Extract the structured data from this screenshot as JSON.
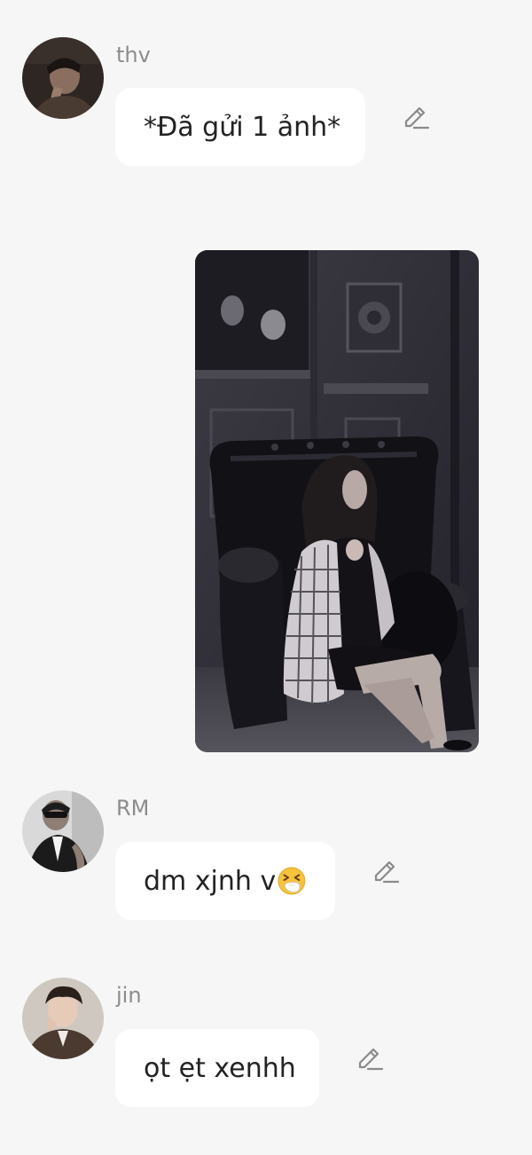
{
  "messages": [
    {
      "sender": "thv",
      "text": "*Đã gửi 1 ảnh*",
      "avatar_icon": "avatar-thv-photo",
      "edit_icon": "pencil-edit-icon"
    },
    {
      "sender": "RM",
      "text": "dm xjnh v",
      "emoji": "sneezing-face-emoji",
      "avatar_icon": "avatar-rm-photo",
      "edit_icon": "pencil-edit-icon"
    },
    {
      "sender": "jin",
      "text": "ọt ẹt xenhh",
      "avatar_icon": "avatar-jin-photo",
      "edit_icon": "pencil-edit-icon"
    }
  ],
  "attachment": {
    "type": "image",
    "subject": "woman-seated-in-black-leather-armchair-photo"
  },
  "colors": {
    "background": "#f6f6f6",
    "bubble": "#ffffff",
    "sender_name": "#8c8c8c",
    "message_text": "#222222",
    "icon": "#8a8a8a"
  }
}
